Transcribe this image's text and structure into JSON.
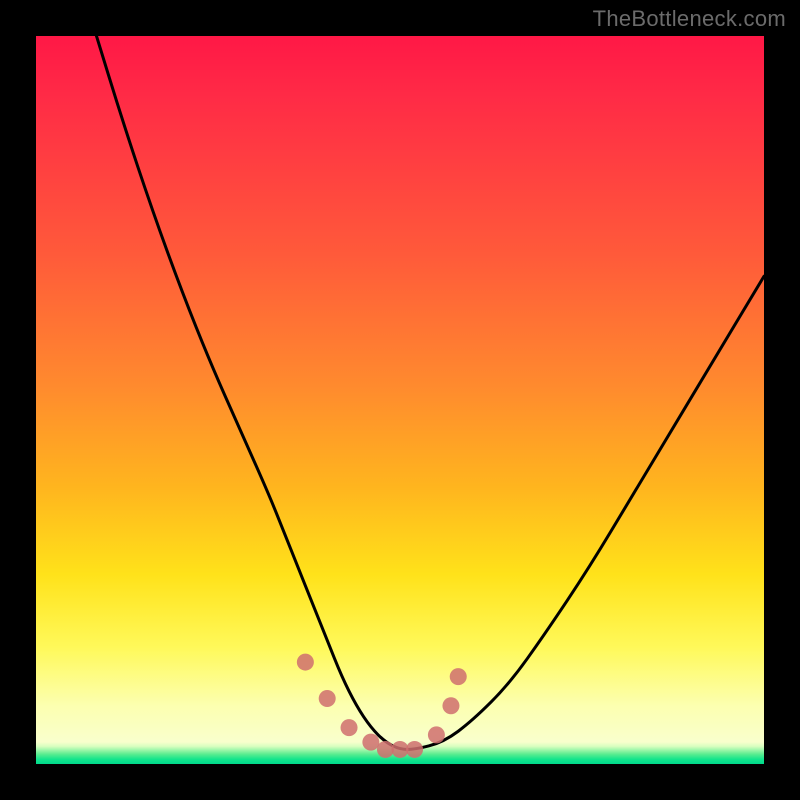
{
  "watermark": "TheBottleneck.com",
  "chart_data": {
    "type": "line",
    "title": "",
    "xlabel": "",
    "ylabel": "",
    "xlim": [
      0,
      100
    ],
    "ylim": [
      0,
      100
    ],
    "grid": false,
    "legend": false,
    "series": [
      {
        "name": "curve",
        "color": "#000000",
        "x": [
          8,
          12,
          16,
          20,
          24,
          28,
          32,
          34,
          36,
          38,
          40,
          42,
          44,
          46,
          48,
          50,
          52,
          56,
          60,
          65,
          70,
          76,
          82,
          88,
          94,
          100
        ],
        "y": [
          101,
          88,
          76,
          65,
          55,
          46,
          37,
          32,
          27,
          22,
          17,
          12,
          8,
          5,
          3,
          2,
          2,
          3,
          6,
          11,
          18,
          27,
          37,
          47,
          57,
          67
        ]
      },
      {
        "name": "markers",
        "type": "scatter",
        "color": "#cf6e6e",
        "x": [
          37,
          40,
          43,
          46,
          48,
          50,
          52,
          55,
          57,
          58
        ],
        "y": [
          14,
          9,
          5,
          3,
          2,
          2,
          2,
          4,
          8,
          12
        ]
      }
    ],
    "background_gradient": {
      "stops": [
        {
          "pos": 0.0,
          "color": "#ff1846"
        },
        {
          "pos": 0.48,
          "color": "#ff8a2e"
        },
        {
          "pos": 0.84,
          "color": "#fff95a"
        },
        {
          "pos": 0.97,
          "color": "#14e58c"
        },
        {
          "pos": 1.0,
          "color": "#00d98c"
        }
      ]
    }
  }
}
